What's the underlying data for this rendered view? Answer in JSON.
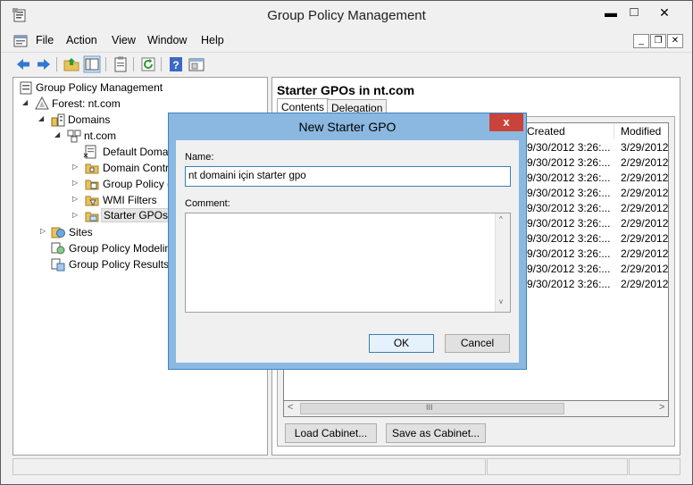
{
  "window": {
    "title": "Group Policy Management",
    "controls": {
      "minimize": "▬",
      "maximize": "□",
      "close": "✕"
    }
  },
  "menu": {
    "items": [
      "File",
      "Action",
      "View",
      "Window",
      "Help"
    ],
    "mdi_controls": {
      "minimize": "_",
      "restore": "❐",
      "close": "✕"
    }
  },
  "toolbar": {
    "icons": [
      "back-arrow-icon",
      "forward-arrow-icon",
      "folder-up-icon",
      "show-hide-tree-icon",
      "clipboard-icon",
      "refresh-icon",
      "help-icon",
      "console-properties-icon"
    ]
  },
  "tree": {
    "items": [
      {
        "label": "Group Policy Management",
        "icon": "gpm-root-icon",
        "twisty": ""
      },
      {
        "label": "Forest: nt.com",
        "icon": "forest-icon",
        "twisty": "◢"
      },
      {
        "label": "Domains",
        "icon": "domains-icon",
        "twisty": "◢"
      },
      {
        "label": "nt.com",
        "icon": "domain-icon",
        "twisty": "◢"
      },
      {
        "label": "Default Doma",
        "icon": "gpo-link-icon",
        "twisty": ""
      },
      {
        "label": "Domain Contr",
        "icon": "ou-folder-icon",
        "twisty": "▷"
      },
      {
        "label": "Group Policy (",
        "icon": "gpo-folder-icon",
        "twisty": "▷"
      },
      {
        "label": "WMI Filters",
        "icon": "wmi-folder-icon",
        "twisty": "▷"
      },
      {
        "label": "Starter GPOs",
        "icon": "starter-gpo-folder-icon",
        "twisty": "▷"
      },
      {
        "label": "Sites",
        "icon": "sites-icon",
        "twisty": "▷"
      },
      {
        "label": "Group Policy Modelin",
        "icon": "modeling-icon",
        "twisty": ""
      },
      {
        "label": "Group Policy Results",
        "icon": "results-icon",
        "twisty": ""
      }
    ]
  },
  "right_pane": {
    "title": "Starter GPOs in nt.com",
    "tabs": [
      "Contents",
      "Delegation"
    ],
    "columns": [
      "Created",
      "Modified"
    ],
    "rows": [
      {
        "created": "9/30/2012 3:26:...",
        "modified": "3/29/2012"
      },
      {
        "created": "9/30/2012 3:26:...",
        "modified": "2/29/2012"
      },
      {
        "created": "9/30/2012 3:26:...",
        "modified": "2/29/2012"
      },
      {
        "created": "9/30/2012 3:26:...",
        "modified": "2/29/2012"
      },
      {
        "created": "9/30/2012 3:26:...",
        "modified": "2/29/2012"
      },
      {
        "created": "9/30/2012 3:26:...",
        "modified": "2/29/2012"
      },
      {
        "created": "9/30/2012 3:26:...",
        "modified": "2/29/2012"
      },
      {
        "created": "9/30/2012 3:26:...",
        "modified": "2/29/2012"
      },
      {
        "created": "9/30/2012 3:26:...",
        "modified": "2/29/2012"
      },
      {
        "created": "9/30/2012 3:26:...",
        "modified": "2/29/2012"
      }
    ],
    "scroll_left": "<",
    "scroll_right": ">",
    "scroll_grip": "III",
    "buttons": {
      "load_cabinet": "Load Cabinet...",
      "save_as_cabinet": "Save as Cabinet..."
    }
  },
  "dialog": {
    "title": "New Starter GPO",
    "close": "x",
    "name_label": "Name:",
    "name_value": "nt domaini için starter gpo",
    "comment_label": "Comment:",
    "comment_value": "",
    "scroll_up": "^",
    "scroll_down": "v",
    "ok": "OK",
    "cancel": "Cancel"
  }
}
